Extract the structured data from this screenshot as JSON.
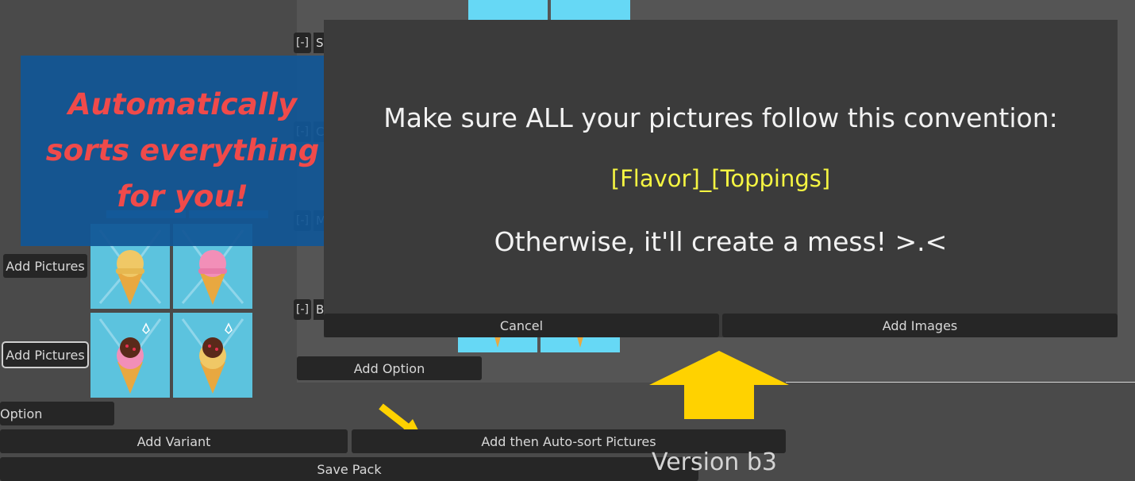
{
  "colors": {
    "arrow": "#ffd200",
    "promo_text": "#f04a4a",
    "convention_text": "#f5f542",
    "button_bg": "#262626",
    "dialog_bg": "#3b3b3b"
  },
  "left_panel": {
    "add_pictures_1": "Add Pictures",
    "add_pictures_2": "Add Pictures",
    "option_label": "Option"
  },
  "promo": {
    "line1": "Automatically",
    "line2": "sorts everything",
    "line3": "for you!"
  },
  "behind_rows": [
    {
      "collapse": "[-]",
      "letter": "S"
    },
    {
      "collapse": "[-]",
      "letter": "C"
    },
    {
      "collapse": "[-]",
      "letter": "M"
    },
    {
      "collapse": "[-]",
      "letter": "B"
    }
  ],
  "dialog": {
    "title": "Make sure ALL your pictures follow this convention:",
    "convention": "[Flavor]_[Toppings]",
    "warning": "Otherwise, it'll create a mess! >.<",
    "cancel_label": "Cancel",
    "add_images_label": "Add Images"
  },
  "add_option_label": "Add Option",
  "bottom_bar": {
    "add_variant_label": "Add Variant",
    "auto_sort_label": "Add then Auto-sort Pictures",
    "save_pack_label": "Save Pack"
  },
  "version": "Version b3",
  "icons": [
    "ice-cream-vanilla-icon",
    "ice-cream-strawberry-icon",
    "ice-cream-chocolate-strawberry-icon",
    "ice-cream-chocolate-vanilla-icon",
    "arrow-down-right-icon",
    "arrow-up-icon"
  ]
}
